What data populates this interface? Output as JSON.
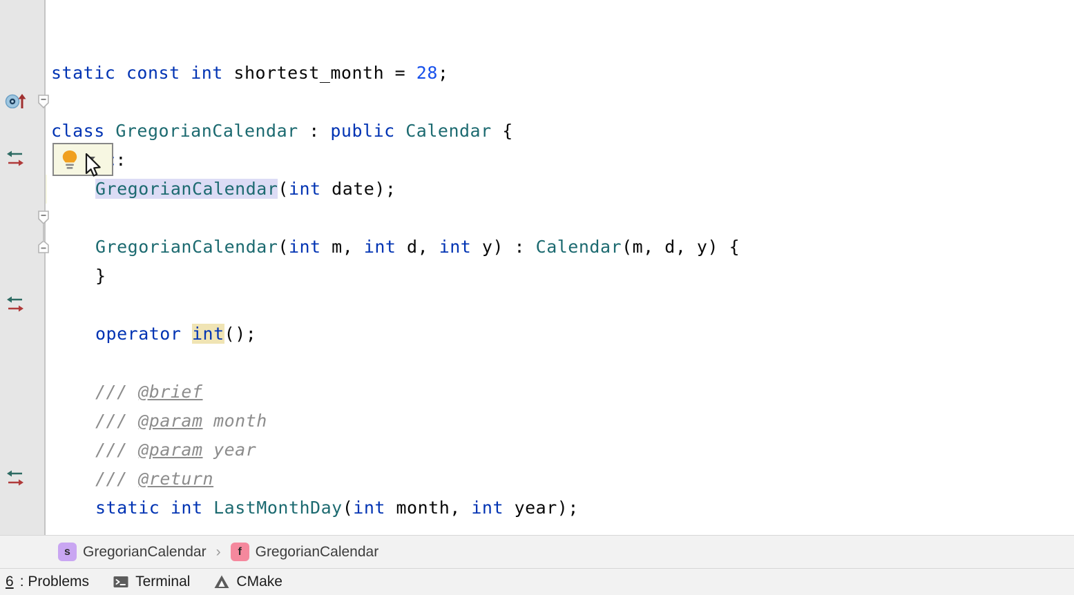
{
  "editor": {
    "language": "cpp",
    "caret_line_index": 3,
    "lines": [
      {
        "id": "line-blank-top",
        "tokens": []
      },
      {
        "id": "line-shortest-month",
        "tokens": [
          {
            "t": "static",
            "c": "kw"
          },
          {
            "t": " ",
            "c": "plain"
          },
          {
            "t": "const",
            "c": "kw"
          },
          {
            "t": " ",
            "c": "plain"
          },
          {
            "t": "int",
            "c": "kw"
          },
          {
            "t": " shortest_month = ",
            "c": "plain"
          },
          {
            "t": "28",
            "c": "num"
          },
          {
            "t": ";",
            "c": "plain"
          }
        ]
      },
      {
        "id": "line-blank-1",
        "tokens": []
      },
      {
        "id": "line-class-decl",
        "tokens": [
          {
            "t": "class",
            "c": "kw"
          },
          {
            "t": " ",
            "c": "plain"
          },
          {
            "t": "GregorianCalendar",
            "c": "type"
          },
          {
            "t": " : ",
            "c": "plain"
          },
          {
            "t": "public",
            "c": "kw"
          },
          {
            "t": " ",
            "c": "plain"
          },
          {
            "t": "Calendar",
            "c": "type"
          },
          {
            "t": " {",
            "c": "plain"
          }
        ]
      },
      {
        "id": "line-public-label",
        "tokens": [
          {
            "t": "public",
            "c": "kw"
          },
          {
            "t": ":",
            "c": "plain"
          }
        ]
      },
      {
        "id": "line-ctor-date",
        "tokens": [
          {
            "t": "GregorianCalendar",
            "c": "sel-ident"
          },
          {
            "t": "(",
            "c": "plain"
          },
          {
            "t": "int",
            "c": "kw"
          },
          {
            "t": " date);",
            "c": "plain"
          }
        ]
      },
      {
        "id": "line-blank-2",
        "tokens": []
      },
      {
        "id": "line-ctor-mdy",
        "tokens": [
          {
            "t": "GregorianCalendar",
            "c": "type"
          },
          {
            "t": "(",
            "c": "plain"
          },
          {
            "t": "int",
            "c": "kw"
          },
          {
            "t": " m, ",
            "c": "plain"
          },
          {
            "t": "int",
            "c": "kw"
          },
          {
            "t": " d, ",
            "c": "plain"
          },
          {
            "t": "int",
            "c": "kw"
          },
          {
            "t": " y) : ",
            "c": "plain"
          },
          {
            "t": "Calendar",
            "c": "type"
          },
          {
            "t": "(m, d, y) {",
            "c": "plain"
          }
        ]
      },
      {
        "id": "line-ctor-close",
        "tokens": [
          {
            "t": "}",
            "c": "plain"
          }
        ]
      },
      {
        "id": "line-blank-3",
        "tokens": []
      },
      {
        "id": "line-operator-int",
        "tokens": [
          {
            "t": "operator",
            "c": "kw"
          },
          {
            "t": " ",
            "c": "plain"
          },
          {
            "t": "int",
            "c": "hl-usage kw"
          },
          {
            "t": "();",
            "c": "plain"
          }
        ]
      },
      {
        "id": "line-blank-4",
        "tokens": []
      },
      {
        "id": "line-doc-brief",
        "tokens": [
          {
            "t": "/// ",
            "c": "doc"
          },
          {
            "t": "@brief",
            "c": "doctag"
          }
        ]
      },
      {
        "id": "line-doc-param-month",
        "tokens": [
          {
            "t": "/// ",
            "c": "doc"
          },
          {
            "t": "@param",
            "c": "doctag"
          },
          {
            "t": " month",
            "c": "doc"
          }
        ]
      },
      {
        "id": "line-doc-param-year",
        "tokens": [
          {
            "t": "/// ",
            "c": "doc"
          },
          {
            "t": "@param",
            "c": "doctag"
          },
          {
            "t": " year",
            "c": "doc"
          }
        ]
      },
      {
        "id": "line-doc-return",
        "tokens": [
          {
            "t": "/// ",
            "c": "doc"
          },
          {
            "t": "@return",
            "c": "doctag"
          }
        ]
      },
      {
        "id": "line-lastmonthday",
        "tokens": [
          {
            "t": "static",
            "c": "kw"
          },
          {
            "t": " ",
            "c": "plain"
          },
          {
            "t": "int",
            "c": "kw"
          },
          {
            "t": " ",
            "c": "plain"
          },
          {
            "t": "LastMonthDay",
            "c": "type"
          },
          {
            "t": "(",
            "c": "plain"
          },
          {
            "t": "int",
            "c": "kw"
          },
          {
            "t": " month, ",
            "c": "plain"
          },
          {
            "t": "int",
            "c": "kw"
          },
          {
            "t": " year);",
            "c": "plain"
          }
        ]
      }
    ],
    "gutter_icons": [
      {
        "name": "class-overridden-marker",
        "icon": "class-up-arrow",
        "line": 3
      },
      {
        "name": "implementing-method-marker",
        "icon": "implement-override-arrows",
        "line": 5
      },
      {
        "name": "implementing-method-marker",
        "icon": "implement-override-arrows",
        "line": 10
      },
      {
        "name": "implementing-method-marker",
        "icon": "implement-override-arrows",
        "line": 16
      }
    ],
    "fold_markers": [
      {
        "name": "fold-collapse-class",
        "icon": "fold-minus-top",
        "line": 3
      },
      {
        "name": "fold-collapse-ctor",
        "icon": "fold-minus-top",
        "line": 7
      },
      {
        "name": "fold-collapse-ctor-end",
        "icon": "fold-minus-bottom",
        "line": 8
      }
    ]
  },
  "intention_popup": {
    "name": "intention-bulb-popup",
    "bulb_icon": "lightbulb-icon",
    "chevron_icon": "chevron-down-icon",
    "accent_color": "#f0a020"
  },
  "cursor": {
    "name": "mouse-pointer",
    "icon": "arrow-cursor"
  },
  "breadcrumb": {
    "items": [
      {
        "badge": "s",
        "badge_kind": "struct",
        "label": "GregorianCalendar"
      },
      {
        "badge": "f",
        "badge_kind": "function",
        "label": "GregorianCalendar"
      }
    ],
    "separator": "›"
  },
  "statusbar": {
    "items": [
      {
        "mnemonic": "6",
        "label": ": Problems",
        "icon": null
      },
      {
        "mnemonic": "",
        "label": "Terminal",
        "icon": "terminal-icon"
      },
      {
        "mnemonic": "",
        "label": "CMake",
        "icon": "cmake-icon"
      }
    ]
  },
  "colors": {
    "keyword": "#0033b3",
    "type": "#1c6a70",
    "number": "#1750eb",
    "doc_comment": "#8c8c8c",
    "caret_row": "#f7f7e2",
    "selection": "#dcdcf5",
    "usage_highlight": "#f0e4b4",
    "gutter": "#e6e6e6",
    "struct_badge": "#c9a6f2",
    "function_badge": "#f5889d"
  }
}
